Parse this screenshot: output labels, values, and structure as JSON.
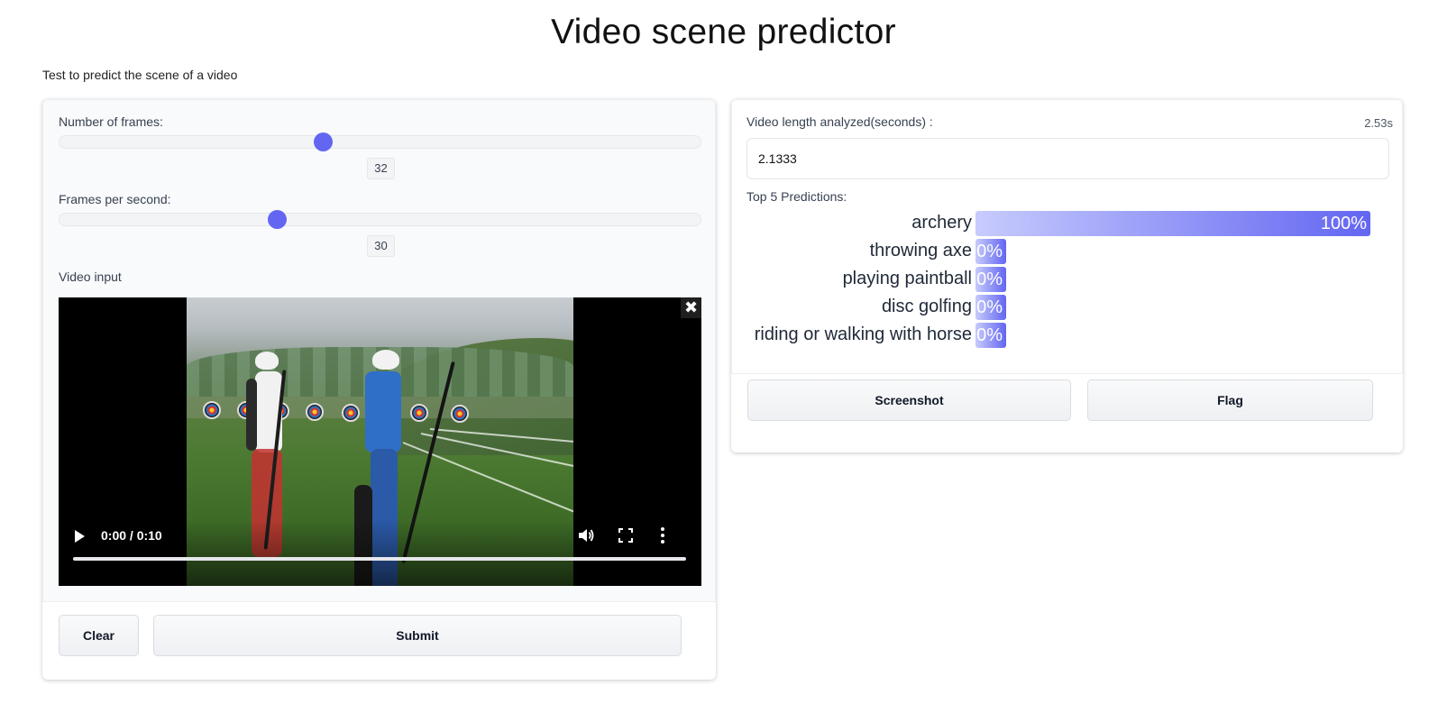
{
  "page": {
    "title": "Video scene predictor",
    "description": "Test to predict the scene of a video"
  },
  "inputs": {
    "frames_slider": {
      "label": "Number of frames:",
      "value": "32",
      "fraction": 0.41
    },
    "fps_slider": {
      "label": "Frames per second:",
      "value": "30",
      "fraction": 0.338
    },
    "video": {
      "label": "Video input",
      "time": "0:00 / 0:10",
      "clear_icon": "close-icon",
      "play_icon": "play-icon",
      "volume_icon": "volume-icon",
      "fullscreen_icon": "fullscreen-icon",
      "more_icon": "more-vertical-icon"
    }
  },
  "actions": {
    "clear_label": "Clear",
    "submit_label": "Submit"
  },
  "outputs": {
    "video_length": {
      "label": "Video length analyzed(seconds) :",
      "value": "2.1333",
      "timer": "2.53s"
    },
    "predictions": {
      "label": "Top 5 Predictions:",
      "items": [
        {
          "label": "archery",
          "percent": "100%",
          "confidence": 1.0
        },
        {
          "label": "throwing axe",
          "percent": "0%",
          "confidence": 0.0
        },
        {
          "label": "playing paintball",
          "percent": "0%",
          "confidence": 0.0
        },
        {
          "label": "disc golfing",
          "percent": "0%",
          "confidence": 0.0
        },
        {
          "label": "riding or walking with horse",
          "percent": "0%",
          "confidence": 0.0
        }
      ]
    }
  },
  "output_actions": {
    "screenshot_label": "Screenshot",
    "flag_label": "Flag"
  },
  "colors": {
    "accent": "#6366f1",
    "bar_start": "#c7cbfd"
  }
}
